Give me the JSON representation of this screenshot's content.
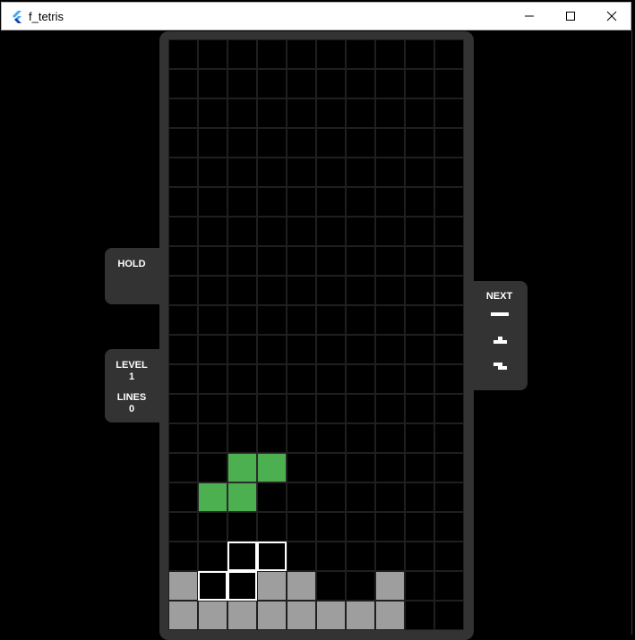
{
  "window": {
    "title": "f_tetris",
    "icon": "flutter-logo-icon",
    "controls": [
      "minimize-icon",
      "maximize-icon",
      "close-icon"
    ]
  },
  "panels": {
    "hold": {
      "label": "HOLD"
    },
    "stats": {
      "level_label": "LEVEL",
      "level_value": "1",
      "lines_label": "LINES",
      "lines_value": "0"
    },
    "next": {
      "label": "NEXT",
      "queue": [
        "I",
        "T",
        "Z"
      ]
    }
  },
  "board": {
    "columns": 10,
    "rows": 20,
    "active_piece": {
      "type": "S",
      "color": "#4caf50",
      "cells": [
        [
          2,
          14
        ],
        [
          3,
          14
        ],
        [
          1,
          15
        ],
        [
          2,
          15
        ]
      ]
    },
    "ghost_cells": [
      [
        2,
        17
      ],
      [
        3,
        17
      ],
      [
        1,
        18
      ],
      [
        2,
        18
      ]
    ],
    "locked_cells": [
      [
        0,
        18
      ],
      [
        3,
        18
      ],
      [
        4,
        18
      ],
      [
        7,
        18
      ],
      [
        0,
        19
      ],
      [
        1,
        19
      ],
      [
        2,
        19
      ],
      [
        3,
        19
      ],
      [
        4,
        19
      ],
      [
        5,
        19
      ],
      [
        6,
        19
      ],
      [
        7,
        19
      ]
    ],
    "locked_color": "#9e9e9e"
  },
  "colors": {
    "background": "#000000",
    "frame": "#333333",
    "grid": "#1f1f1f",
    "text": "#ffffff"
  }
}
